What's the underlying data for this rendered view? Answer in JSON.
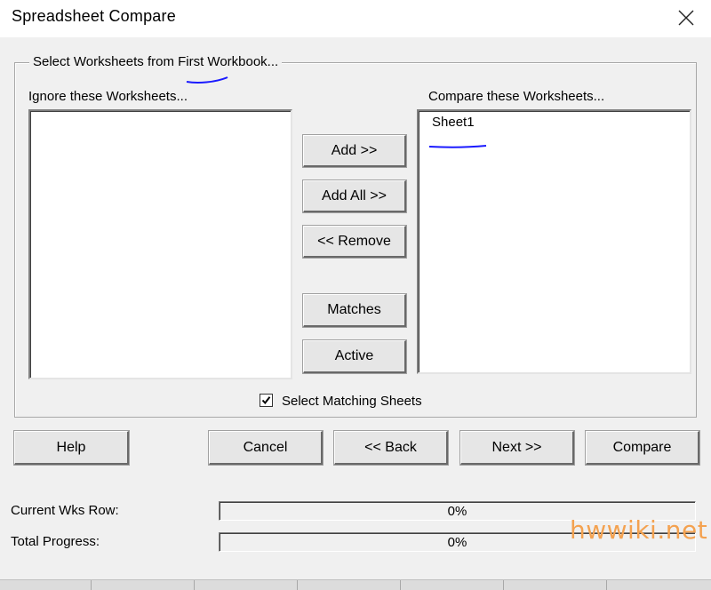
{
  "window": {
    "title": "Spreadsheet Compare",
    "close_glyph": "✕"
  },
  "group": {
    "legend": "Select Worksheets from First Workbook..."
  },
  "left_list": {
    "label": "Ignore these Worksheets...",
    "items": []
  },
  "right_list": {
    "label": "Compare these Worksheets...",
    "items": [
      "Sheet1"
    ]
  },
  "middle_buttons": {
    "add": "Add >>",
    "add_all": "Add All >>",
    "remove": "<< Remove",
    "matches": "Matches",
    "active": "Active"
  },
  "select_matching": {
    "label": "Select Matching Sheets",
    "checked": true,
    "check_glyph": "✔"
  },
  "bottom_buttons": {
    "help": "Help",
    "cancel": "Cancel",
    "back": "<< Back",
    "next": "Next >>",
    "compare": "Compare"
  },
  "progress": {
    "current_label": "Current Wks Row:",
    "current_value": "0%",
    "current_fraction": 0,
    "total_label": "Total Progress:",
    "total_value": "0%",
    "total_fraction": 0
  },
  "watermark": {
    "text": "hwwiki.net",
    "color": "#f4a250"
  },
  "colors": {
    "annotation_underline": "#1a1aff",
    "progress_fill": "#3a6ea5"
  }
}
